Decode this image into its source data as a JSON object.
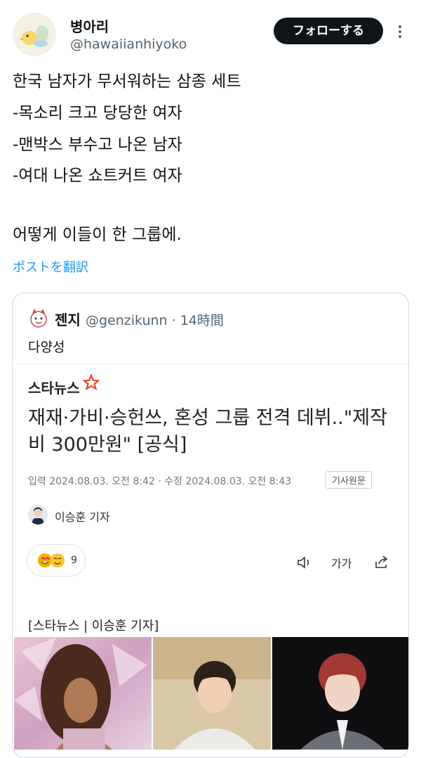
{
  "colors": {
    "accent": "#1d9bf0",
    "text": "#0f1419",
    "secondary": "#536471",
    "star": "#e8472b"
  },
  "tweet": {
    "author_name": "병아리",
    "author_handle": "@hawaiianhiyoko",
    "follow_label": "フォローする",
    "more_icon": "more-vertical-icon",
    "lines": [
      "한국 남자가 무서워하는 삼종 세트",
      "-목소리 크고 당당한 여자",
      "-맨박스 부수고 나온 남자",
      "-여대 나온 쇼트커트 여자",
      "",
      "어떻게 이들이 한 그룹에."
    ],
    "translate_label": "ポストを翻訳"
  },
  "quote": {
    "author_name": "젠지",
    "author_meta": "@genzikunn · 14時間",
    "text": "다양성",
    "article": {
      "source": "스타뉴스",
      "headline": "재재·가비·승헌쓰, 혼성 그룹 전격 데뷔..\"제작비 300만원\" [공식]",
      "dates": "입력 2024.08.03. 오전 8:42 · 수정 2024.08.03. 오전 8:43",
      "original_label": "기사원문",
      "reporter": "이승훈 기자",
      "reaction_count": "9",
      "font_size_label": "가가",
      "caption": "[스타뉴스 | 이승훈 기자]"
    }
  }
}
